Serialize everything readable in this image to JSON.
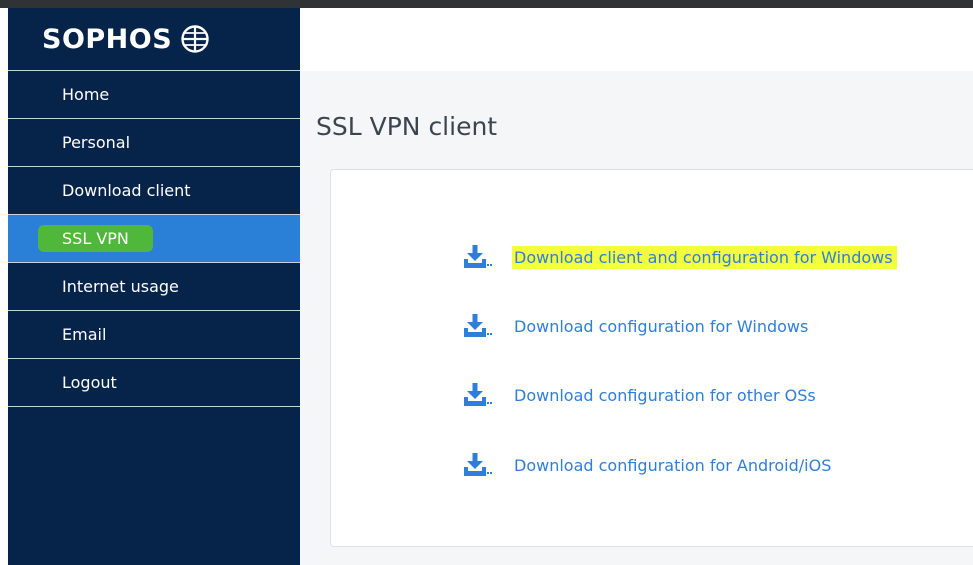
{
  "brand": {
    "name": "SOPHOS"
  },
  "sidebar": {
    "items": [
      {
        "label": "Home",
        "active": false
      },
      {
        "label": "Personal",
        "active": false
      },
      {
        "label": "Download client",
        "active": false
      },
      {
        "label": "SSL VPN",
        "active": true
      },
      {
        "label": "Internet usage",
        "active": false
      },
      {
        "label": "Email",
        "active": false
      },
      {
        "label": "Logout",
        "active": false
      }
    ]
  },
  "main": {
    "title": "SSL VPN client",
    "downloads": [
      {
        "label": "Download client and configuration for Windows",
        "icon": "download-icon",
        "highlighted": true
      },
      {
        "label": "Download configuration for Windows",
        "icon": "download-icon",
        "highlighted": false
      },
      {
        "label": "Download configuration for other OSs",
        "icon": "download-icon",
        "highlighted": false
      },
      {
        "label": "Download configuration for Android/iOS",
        "icon": "download-icon",
        "highlighted": false
      }
    ]
  },
  "colors": {
    "sidebar_bg": "#062349",
    "active_item": "#2980d6",
    "link": "#2f7ed8",
    "highlight": "#f3ff3c",
    "green_marker": "#4fb83a"
  }
}
